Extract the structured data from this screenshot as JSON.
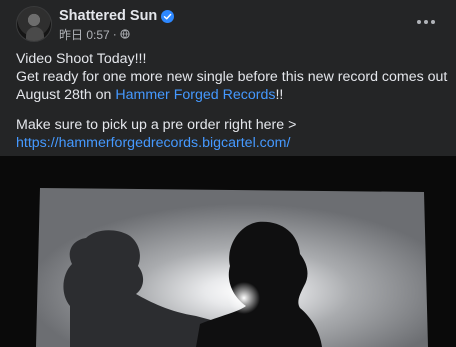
{
  "post": {
    "author": "Shattered Sun",
    "timestamp": "昨日 0:57",
    "separator": "·",
    "privacy_icon": "globe-icon",
    "more_icon": "more-options-icon",
    "verified_icon": "verified-badge-icon",
    "lines": {
      "line1": "Video Shoot Today!!!",
      "line2": "Get ready for one more new single before this new record comes out",
      "line3_pre": "August 28th on ",
      "line3_link": "Hammer Forged Records",
      "line3_post": "!!",
      "line4": "Make sure to pick up a pre order right here >",
      "line5_link": "https://hammerforgedrecords.bigcartel.com/"
    },
    "colors": {
      "background": "#242526",
      "text": "#e4e6eb",
      "secondary_text": "#b0b3b8",
      "link": "#4599ff",
      "verified": "#2d88ff"
    }
  }
}
